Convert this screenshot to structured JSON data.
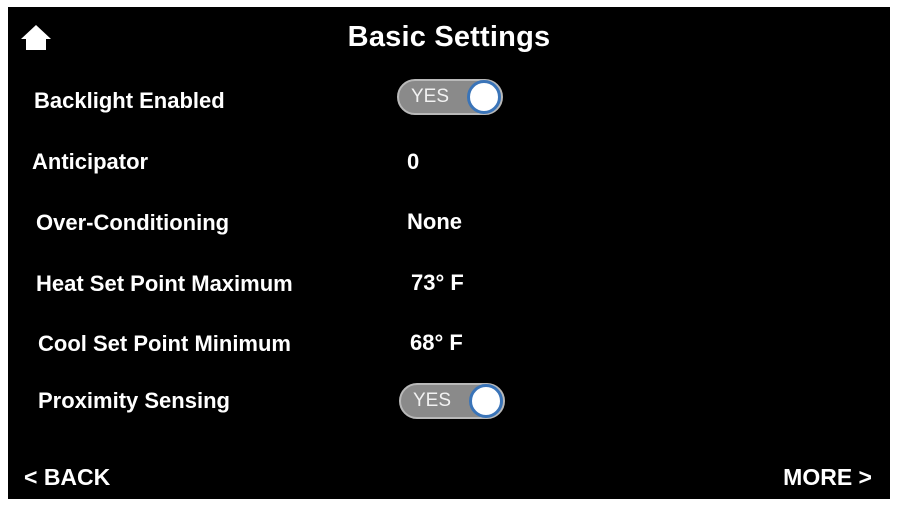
{
  "header": {
    "title": "Basic Settings",
    "home_icon": "home-icon"
  },
  "settings": [
    {
      "label": "Backlight Enabled",
      "type": "toggle",
      "value": "YES"
    },
    {
      "label": "Anticipator",
      "type": "value",
      "value": "0"
    },
    {
      "label": "Over-Conditioning",
      "type": "value",
      "value": "None"
    },
    {
      "label": "Heat Set Point Maximum",
      "type": "value",
      "value": "73° F"
    },
    {
      "label": "Cool Set Point Minimum",
      "type": "value",
      "value": "68° F"
    },
    {
      "label": "Proximity Sensing",
      "type": "toggle",
      "value": "YES"
    }
  ],
  "footer": {
    "back_label": "< BACK",
    "more_label": "MORE >"
  },
  "colors": {
    "background": "#000000",
    "text": "#ffffff",
    "toggle_track": "#8a8a8a",
    "knob_border": "#3a74b8"
  }
}
